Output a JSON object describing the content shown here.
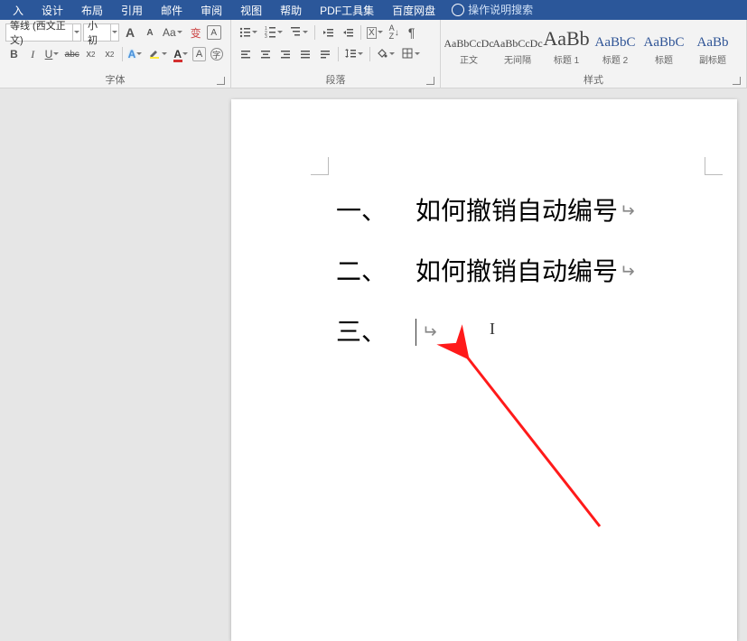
{
  "menu": {
    "items": [
      "入",
      "设计",
      "布局",
      "引用",
      "邮件",
      "审阅",
      "视图",
      "帮助",
      "PDF工具集",
      "百度网盘"
    ],
    "search_placeholder": "操作说明搜索"
  },
  "ribbon": {
    "font": {
      "name": "等线 (西文正文)",
      "size": "小初",
      "buttons": {
        "grow": "A",
        "shrink": "A",
        "case": "Aa",
        "clear": "A",
        "bold": "B",
        "italic": "I",
        "underline": "U",
        "strike": "abc",
        "sub": "x₂",
        "sup": "x²",
        "effects": "A"
      },
      "label": "字体"
    },
    "para": {
      "label": "段落"
    },
    "styles": {
      "items": [
        {
          "preview": "AaBbCcDc",
          "name": "正文",
          "cls": ""
        },
        {
          "preview": "AaBbCcDc",
          "name": "无间隔",
          "cls": ""
        },
        {
          "preview": "AaBb",
          "name": "标题 1",
          "cls": "big"
        },
        {
          "preview": "AaBbC",
          "name": "标题 2",
          "cls": "med"
        },
        {
          "preview": "AaBbC",
          "name": "标题",
          "cls": "med"
        },
        {
          "preview": "AaBb",
          "name": "副标题",
          "cls": "med"
        }
      ],
      "label": "样式"
    }
  },
  "document": {
    "lines": [
      {
        "num": "一、",
        "text": "如何撤销自动编号",
        "ret": true,
        "caret": false
      },
      {
        "num": "二、",
        "text": "如何撤销自动编号",
        "ret": true,
        "caret": false
      },
      {
        "num": "三、",
        "text": "",
        "ret": true,
        "caret": true
      }
    ]
  }
}
